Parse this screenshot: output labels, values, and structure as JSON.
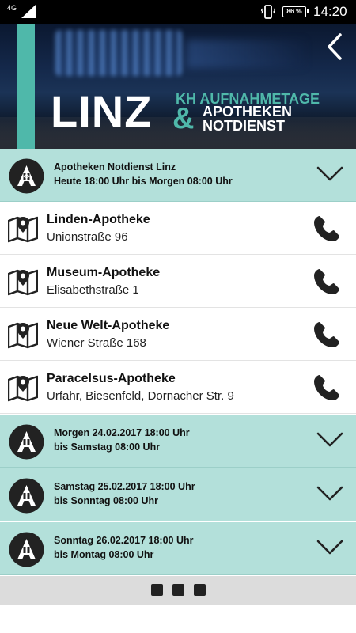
{
  "status_bar": {
    "network": "4G",
    "battery": "86 %",
    "time": "14:20"
  },
  "header": {
    "logo_main": "LINZ",
    "logo_line1": "KH AUFNAHMETAGE",
    "logo_amp": "&",
    "logo_line2": "APOTHEKEN",
    "logo_line3": "NOTDIENST"
  },
  "active_section": {
    "line1": "Apotheken Notdienst Linz",
    "line2": "Heute 18:00 Uhr bis Morgen 08:00 Uhr"
  },
  "pharmacies": [
    {
      "name": "Linden-Apotheke",
      "address": "Unionstraße 96"
    },
    {
      "name": "Museum-Apotheke",
      "address": "Elisabethstraße 1"
    },
    {
      "name": "Neue Welt-Apotheke",
      "address": "Wiener Straße 168"
    },
    {
      "name": "Paracelsus-Apotheke",
      "address": "Urfahr, Biesenfeld, Dornacher Str. 9"
    }
  ],
  "upcoming_sections": [
    {
      "line1": "Morgen 24.02.2017 18:00 Uhr",
      "line2": "bis Samstag 08:00 Uhr"
    },
    {
      "line1": "Samstag 25.02.2017 18:00 Uhr",
      "line2": "bis Sonntag 08:00 Uhr"
    },
    {
      "line1": "Sonntag 26.02.2017 18:00 Uhr",
      "line2": "bis Montag 08:00 Uhr"
    }
  ],
  "colors": {
    "accent_teal": "#4fb8aa",
    "section_bg": "#b3e0da",
    "icon_dark": "#222222"
  },
  "icons": {
    "apotheke": "apotheke-a-logo-icon",
    "map": "map-pin-icon",
    "phone": "phone-icon",
    "expand": "chevron-down-icon",
    "back": "chevron-left-icon"
  }
}
